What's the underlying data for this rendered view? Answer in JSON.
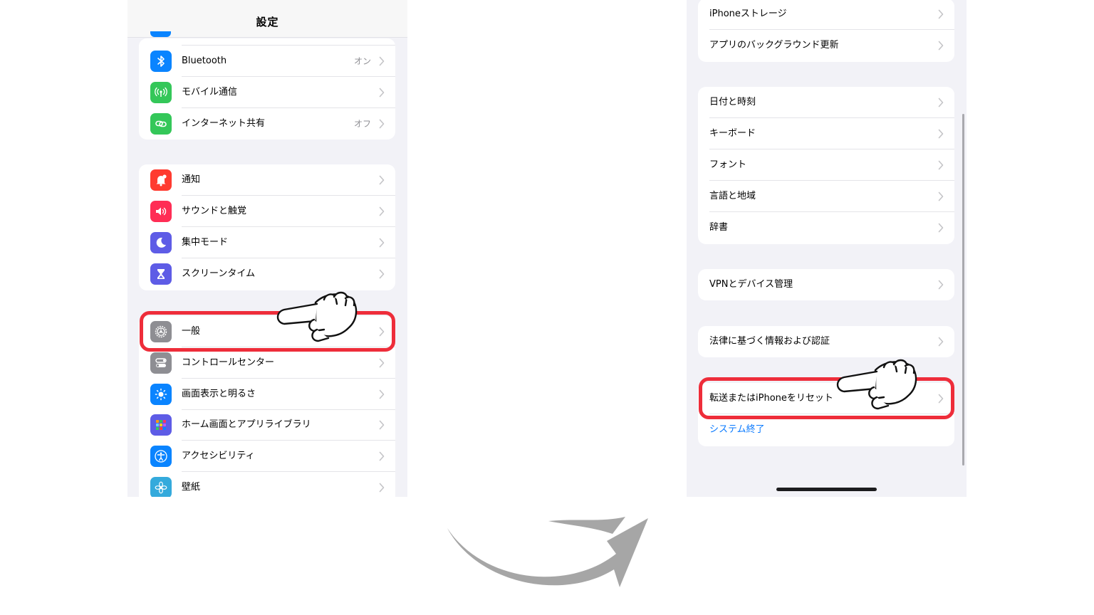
{
  "left_screen": {
    "title": "設定",
    "group_connectivity": [
      {
        "label": "Bluetooth",
        "value": "オン",
        "icon": "bluetooth-icon",
        "color": "#0a84ff"
      },
      {
        "label": "モバイル通信",
        "value": "",
        "icon": "antenna-icon",
        "color": "#34c759"
      },
      {
        "label": "インターネット共有",
        "value": "オフ",
        "icon": "link-icon",
        "color": "#34c759"
      }
    ],
    "group_notifications": [
      {
        "label": "通知",
        "icon": "bell-icon",
        "color": "#ff3b30"
      },
      {
        "label": "サウンドと触覚",
        "icon": "speaker-icon",
        "color": "#ff2d55"
      },
      {
        "label": "集中モード",
        "icon": "moon-icon",
        "color": "#5e5ce6"
      },
      {
        "label": "スクリーンタイム",
        "icon": "hourglass-icon",
        "color": "#5e5ce6"
      }
    ],
    "group_general": [
      {
        "label": "一般",
        "icon": "gear-icon",
        "color": "#8e8e93"
      },
      {
        "label": "コントロールセンター",
        "icon": "toggles-icon",
        "color": "#8e8e93"
      },
      {
        "label": "画面表示と明るさ",
        "icon": "sun-icon",
        "color": "#0a84ff"
      },
      {
        "label": "ホーム画面とアプリライブラリ",
        "icon": "app-grid-icon",
        "color": "#5e5ce6"
      },
      {
        "label": "アクセシビリティ",
        "icon": "accessibility-icon",
        "color": "#0a84ff"
      },
      {
        "label": "壁紙",
        "icon": "flower-icon",
        "color": "#34aadc"
      }
    ]
  },
  "right_screen": {
    "group_storage": [
      "iPhoneストレージ",
      "アプリのバックグラウンド更新"
    ],
    "group_datetime": [
      "日付と時刻",
      "キーボード",
      "フォント",
      "言語と地域",
      "辞書"
    ],
    "group_vpn": [
      "VPNとデバイス管理"
    ],
    "group_legal": [
      "法律に基づく情報および認証"
    ],
    "group_reset": {
      "transfer_reset": "転送またはiPhoneをリセット",
      "shutdown": "システム終了"
    }
  },
  "colors": {
    "highlight": "#ee2d3a",
    "link": "#0a7aff",
    "arrow": "#a6a6a6"
  }
}
